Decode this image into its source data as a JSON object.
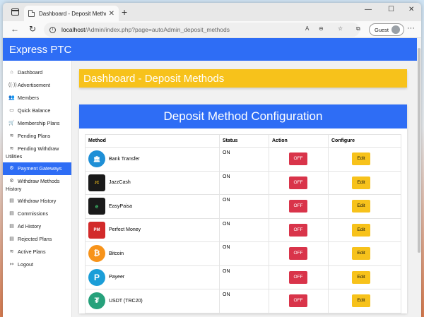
{
  "browser": {
    "tab_title": "Dashboard - Deposit Methods",
    "url_host": "localhost",
    "url_path": "/Admin/index.php?page=autoAdmin_deposit_methods",
    "profile_label": "Guest"
  },
  "app": {
    "brand": "Express PTC"
  },
  "sidebar": {
    "items": [
      {
        "label": "Dashboard"
      },
      {
        "label": "Advertisement"
      },
      {
        "label": "Members"
      },
      {
        "label": "Quick Balance"
      },
      {
        "label": "Membership Plans"
      },
      {
        "label": "Pending Plans"
      },
      {
        "label": "Pending Withdraw",
        "cont": "Utilities"
      },
      {
        "label": "Payment Gateways"
      },
      {
        "label": "Withdraw Methods",
        "cont": "History"
      },
      {
        "label": "Withdraw History"
      },
      {
        "label": "Commissions"
      },
      {
        "label": "Ad History"
      },
      {
        "label": "Rejected Plans"
      },
      {
        "label": "Active Plans"
      },
      {
        "label": "Logout"
      }
    ]
  },
  "page": {
    "title": "Dashboard - Deposit Methods",
    "card_title": "Deposit Method Configuration",
    "columns": [
      "Method",
      "Status",
      "Action",
      "Configure"
    ],
    "rows": [
      {
        "method": "Bank Transfer",
        "status": "ON",
        "action": "OFF",
        "configure": "Edit"
      },
      {
        "method": "JazzCash",
        "status": "ON",
        "action": "OFF",
        "configure": "Edit"
      },
      {
        "method": "EasyPaisa",
        "status": "ON",
        "action": "OFF",
        "configure": "Edit"
      },
      {
        "method": "Perfect Money",
        "status": "ON",
        "action": "OFF",
        "configure": "Edit"
      },
      {
        "method": "Bitcoin",
        "status": "ON",
        "action": "OFF",
        "configure": "Edit"
      },
      {
        "method": "Payeer",
        "status": "ON",
        "action": "OFF",
        "configure": "Edit"
      },
      {
        "method": "USDT (TRC20)",
        "status": "ON",
        "action": "OFF",
        "configure": "Edit"
      }
    ]
  },
  "colors": {
    "primary": "#2e6df5",
    "warning": "#f7c21b",
    "danger": "#d9344a"
  }
}
